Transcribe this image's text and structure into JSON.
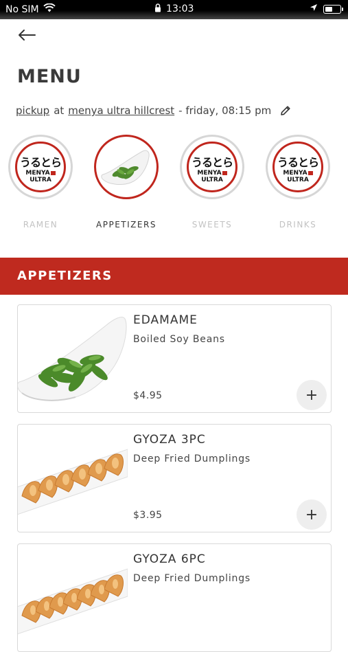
{
  "status_bar": {
    "carrier": "No SIM",
    "time": "13:03"
  },
  "page": {
    "title": "MENU"
  },
  "order": {
    "mode": "pickup",
    "at": "at",
    "location": "menya ultra hillcrest",
    "schedule": "- friday, 08:15 pm"
  },
  "logo": {
    "jp": "うるとら",
    "line1": "MENYA",
    "line2": "ULTRA"
  },
  "categories": [
    {
      "label": "RAMEN",
      "active": false
    },
    {
      "label": "APPETIZERS",
      "active": true
    },
    {
      "label": "SWEETS",
      "active": false
    },
    {
      "label": "DRINKS",
      "active": false
    }
  ],
  "section": {
    "title": "APPETIZERS"
  },
  "items": [
    {
      "name": "EDAMAME",
      "description": "Boiled Soy Beans",
      "price": "$4.95"
    },
    {
      "name": "GYOZA 3PC",
      "description": "Deep Fried Dumplings",
      "price": "$3.95"
    },
    {
      "name": "GYOZA 6PC",
      "description": "Deep Fried Dumplings",
      "price": ""
    }
  ],
  "add_label": "+",
  "colors": {
    "brand_red": "#bf2a1f",
    "active_border": "#c0261d",
    "inactive_label": "#c2c2c2"
  }
}
